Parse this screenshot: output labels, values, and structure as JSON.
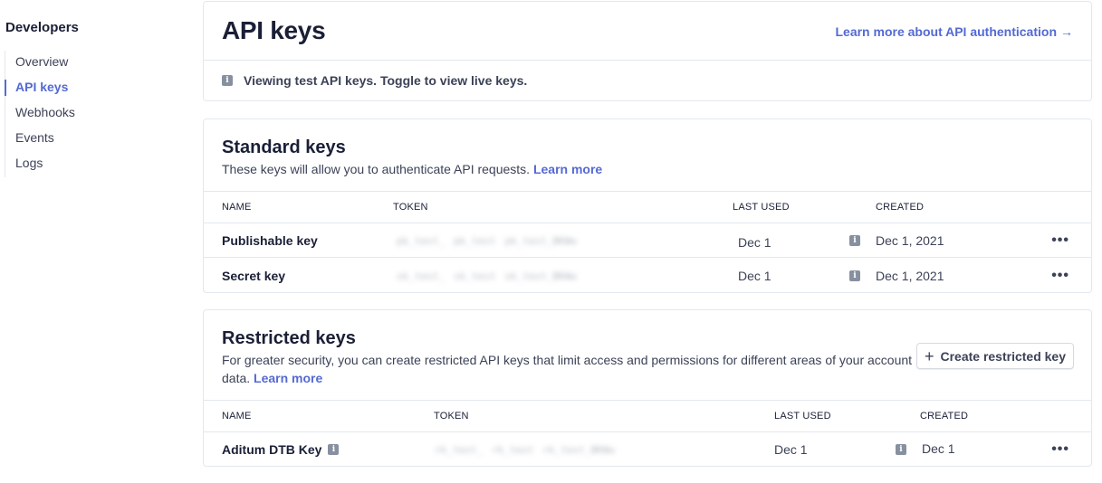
{
  "sidebar": {
    "title": "Developers",
    "items": [
      {
        "label": "Overview",
        "active": false
      },
      {
        "label": "API keys",
        "active": true
      },
      {
        "label": "Webhooks",
        "active": false
      },
      {
        "label": "Events",
        "active": false
      },
      {
        "label": "Logs",
        "active": false
      }
    ]
  },
  "header": {
    "title": "API keys",
    "learn_link": "Learn more about API authentication",
    "learn_arrow": "→",
    "notice": "Viewing test API keys. Toggle to view live keys."
  },
  "standard": {
    "title": "Standard keys",
    "description": "These keys will allow you to authenticate API requests.",
    "learn_more": "Learn more",
    "columns": {
      "name": "NAME",
      "token": "TOKEN",
      "last_used": "LAST USED",
      "created": "CREATED"
    },
    "rows": [
      {
        "name": "Publishable key",
        "token": [
          "pk_test_",
          "pk_test",
          "pk_test_BKWw"
        ],
        "last_used": "Dec 1",
        "created": "Dec  1, 2021"
      },
      {
        "name": "Secret key",
        "token": [
          "sk_test_",
          "sk_test",
          "sk_test_BKWw"
        ],
        "last_used": "Dec 1",
        "created": "Dec  1, 2021"
      }
    ]
  },
  "restricted": {
    "title": "Restricted keys",
    "description": "For greater security, you can create restricted API keys that limit access and permissions for different areas of your account data.",
    "learn_more": "Learn more",
    "create_button": "Create restricted key",
    "columns": {
      "name": "NAME",
      "token": "TOKEN",
      "last_used": "LAST USED",
      "created": "CREATED"
    },
    "rows": [
      {
        "name": "Aditum DTB Key",
        "token": [
          "rk_test_",
          "rk_test",
          "rk_test_BKWw"
        ],
        "last_used": "Dec 1",
        "created": "Dec 1"
      }
    ]
  },
  "icons": {
    "info": "info-icon",
    "more": "more-horizontal-icon",
    "plus": "plus-icon",
    "arrow": "arrow-right-icon"
  },
  "colors": {
    "accent": "#5469d4",
    "text": "#1a1f36",
    "muted": "#3c4257",
    "border": "#e3e8ee"
  }
}
